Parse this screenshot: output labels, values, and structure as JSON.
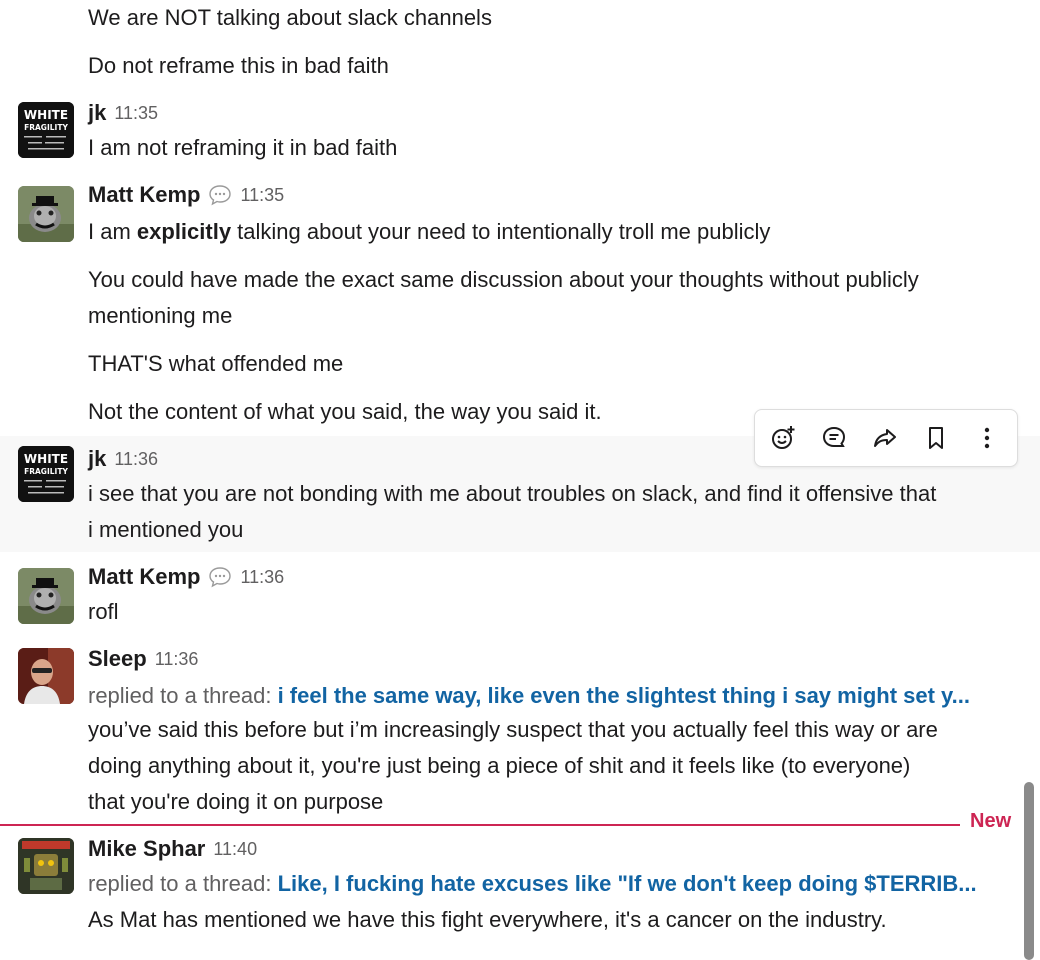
{
  "messages": {
    "m0": {
      "lines": [
        "We are NOT talking about slack channels",
        "Do not reframe this in bad faith"
      ]
    },
    "m1": {
      "author": "jk",
      "time": "11:35",
      "text": "I am not reframing it in bad faith",
      "avatar_text": {
        "t1": "WHITE",
        "t2": "FRAGILITY",
        "small": "WHY IT'S SO HARD FOR WHITE PEOPLE TO TALK ABOUT RACISM"
      }
    },
    "m2": {
      "author": "Matt Kemp",
      "time": "11:35",
      "line1_pre": "I am ",
      "line1_bold": "explicitly",
      "line1_post": " talking about your need to intentionally troll me publicly",
      "line2a": "You could have made the exact same discussion about your thoughts without publicly",
      "line2b": "mentioning me",
      "line3": "THAT'S what offended me",
      "line4": "Not the content of what you said, the way you said it."
    },
    "m3": {
      "author": "jk",
      "time": "11:36",
      "line1": "i see that you are not bonding with me about troubles on slack, and find it offensive that",
      "line2": "i mentioned you"
    },
    "m4": {
      "author": "Matt Kemp",
      "time": "11:36",
      "text": "rofl"
    },
    "m5": {
      "author": "Sleep",
      "time": "11:36",
      "replied_prefix": "replied to a thread: ",
      "thread": "i feel the same way, like even the slightest thing i say might set y...",
      "line1": "you’ve said this before but i’m increasingly suspect that you actually feel this way or are",
      "line2": "doing anything about it, you're just being a piece of shit and it feels like (to everyone)",
      "line3": "that you're doing it on purpose"
    },
    "m6": {
      "author": "Mike Sphar",
      "time": "11:40",
      "replied_prefix": "replied to a thread: ",
      "thread": "Like, I fucking hate excuses like \"If we don't keep doing $TERRIB...",
      "line1": "As Mat has mentioned we have this fight everywhere, it's a cancer on the industry."
    }
  },
  "divider": {
    "label": "New"
  },
  "toolbar": {
    "icons": [
      "add-reaction-icon",
      "reply-in-thread-icon",
      "share-icon",
      "bookmark-icon",
      "more-actions-icon"
    ]
  },
  "colors": {
    "link": "#1264a3",
    "new_divider": "#cd2553",
    "hover_bg": "#f8f8f8"
  }
}
